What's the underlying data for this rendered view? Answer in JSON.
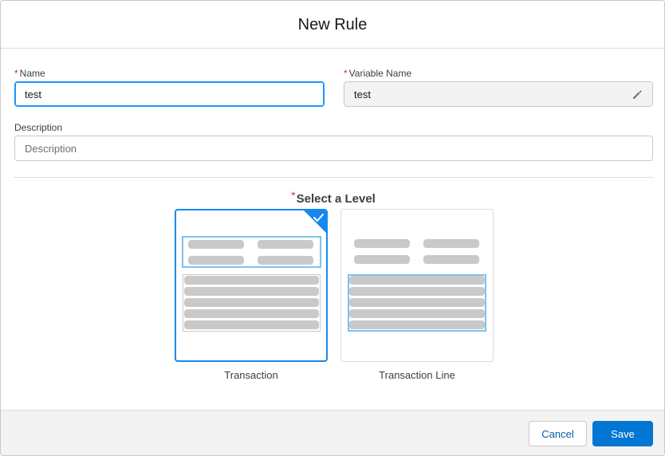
{
  "modal": {
    "title": "New Rule"
  },
  "form": {
    "name": {
      "label": "Name",
      "required_mark": "*",
      "value": "test"
    },
    "variable_name": {
      "label": "Variable Name",
      "required_mark": "*",
      "value": "test",
      "icon": "pencil-icon"
    },
    "description": {
      "label": "Description",
      "placeholder": "Description",
      "value": ""
    }
  },
  "level": {
    "title": "Select a Level",
    "required_mark": "*",
    "options": [
      {
        "label": "Transaction",
        "selected": true
      },
      {
        "label": "Transaction Line",
        "selected": false
      }
    ]
  },
  "footer": {
    "cancel_label": "Cancel",
    "save_label": "Save"
  },
  "colors": {
    "brand": "#0176d3",
    "selected_border": "#1589ee",
    "required": "#c23934",
    "focus": "#1b96ff"
  }
}
